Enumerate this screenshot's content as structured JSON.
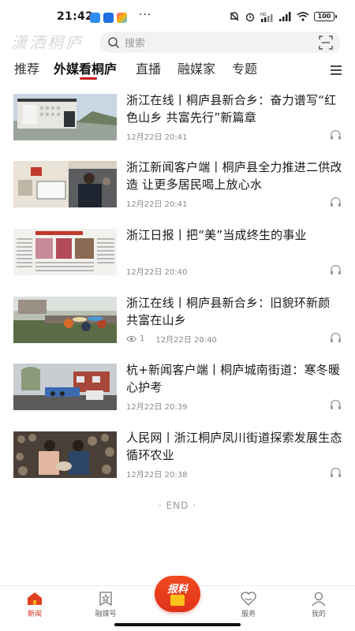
{
  "status_bar": {
    "time": "21:42",
    "dots": "···",
    "battery": "100",
    "network_badge": "HD"
  },
  "header": {
    "logo_text": "潇洒桐庐",
    "search": {
      "placeholder": "搜索"
    }
  },
  "tabs": [
    {
      "label": "推荐",
      "active": false
    },
    {
      "label": "外媒看桐庐",
      "active": true
    },
    {
      "label": "直播",
      "active": false
    },
    {
      "label": "融媒家",
      "active": false
    },
    {
      "label": "专题",
      "active": false
    }
  ],
  "news": [
    {
      "title": "浙江在线丨桐庐县新合乡：奋力谱写“红色山乡 共富先行”新篇章",
      "time": "12月22日 20:41",
      "views": ""
    },
    {
      "title": "浙江新闻客户端丨桐庐县全力推进二供改造 让更多居民喝上放心水",
      "time": "12月22日 20:41",
      "views": ""
    },
    {
      "title": "浙江日报丨把“美”当成终生的事业",
      "time": "12月22日 20:40",
      "views": ""
    },
    {
      "title": "浙江在线丨桐庐县新合乡：旧貌环新颜 共富在山乡",
      "time": "12月22日 20:40",
      "views": "1"
    },
    {
      "title": "杭+新闻客户端丨桐庐城南街道：寒冬暖心护考",
      "time": "12月22日 20:39",
      "views": ""
    },
    {
      "title": "人民网丨浙江桐庐凤川街道探索发展生态循环农业",
      "time": "12月22日 20:38",
      "views": ""
    }
  ],
  "end_text": "· END ·",
  "bottom_nav": {
    "items": [
      {
        "label": "新闻",
        "icon": "home-icon",
        "active": true
      },
      {
        "label": "融媒号",
        "icon": "bookmark-star-icon",
        "active": false
      },
      {
        "label": "服务",
        "icon": "heart-icon",
        "active": false
      },
      {
        "label": "我的",
        "icon": "user-icon",
        "active": false
      }
    ],
    "report_label": "报料"
  },
  "colors": {
    "accent": "#c8151d",
    "report": "#e8391d",
    "meta_text": "#8a8a8a"
  }
}
